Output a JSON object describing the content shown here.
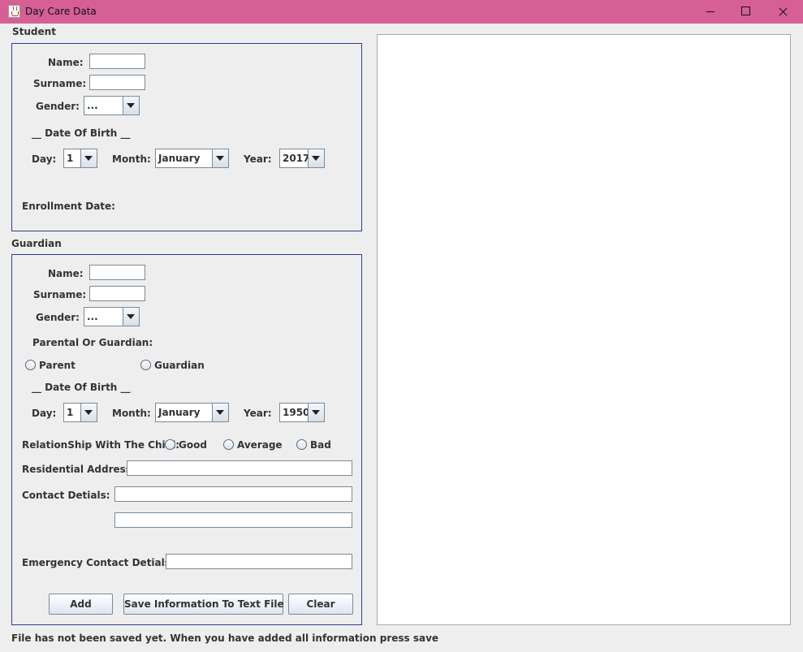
{
  "window": {
    "title": "Day Care Data",
    "titlebar_color": "#d65f96"
  },
  "student": {
    "section_title": "Student",
    "name_label": "Name:",
    "name_value": "",
    "surname_label": "Surname:",
    "surname_value": "",
    "gender_label": "Gender:",
    "gender_value": "...",
    "dob_heading": "__ Date Of Birth __",
    "day_label": "Day:",
    "day_value": "1",
    "month_label": "Month:",
    "month_value": "January",
    "year_label": "Year:",
    "year_value": "2017",
    "enrollment_label": "Enrollment Date:"
  },
  "guardian": {
    "section_title": "Guardian",
    "name_label": "Name:",
    "name_value": "",
    "surname_label": "Surname:",
    "surname_value": "",
    "gender_label": "Gender:",
    "gender_value": "...",
    "type_label": "Parental Or Guardian:",
    "parent_option": "Parent",
    "guardian_option": "Guardian",
    "dob_heading": "__ Date Of Birth __",
    "day_label": "Day:",
    "day_value": "1",
    "month_label": "Month:",
    "month_value": "January",
    "year_label": "Year:",
    "year_value": "1950",
    "relationship_label": "RelationShip With The Child:",
    "relationship_options": [
      "Good",
      "Average",
      "Bad"
    ],
    "address_label": "Residential Address:",
    "address_value": "",
    "contact_label": "Contact Detials:",
    "contact_value_1": "",
    "contact_value_2": "",
    "emergency_label": "Emergency Contact Detials:",
    "emergency_value": ""
  },
  "buttons": {
    "add": "Add",
    "save": "Save Information To Text File",
    "clear": "Clear"
  },
  "status_text": "File has not been saved yet. When you have added all information press save",
  "output_area": {
    "text": ""
  },
  "colors": {
    "panel_border": "#2a3e92",
    "window_bg": "#eeeeee"
  }
}
